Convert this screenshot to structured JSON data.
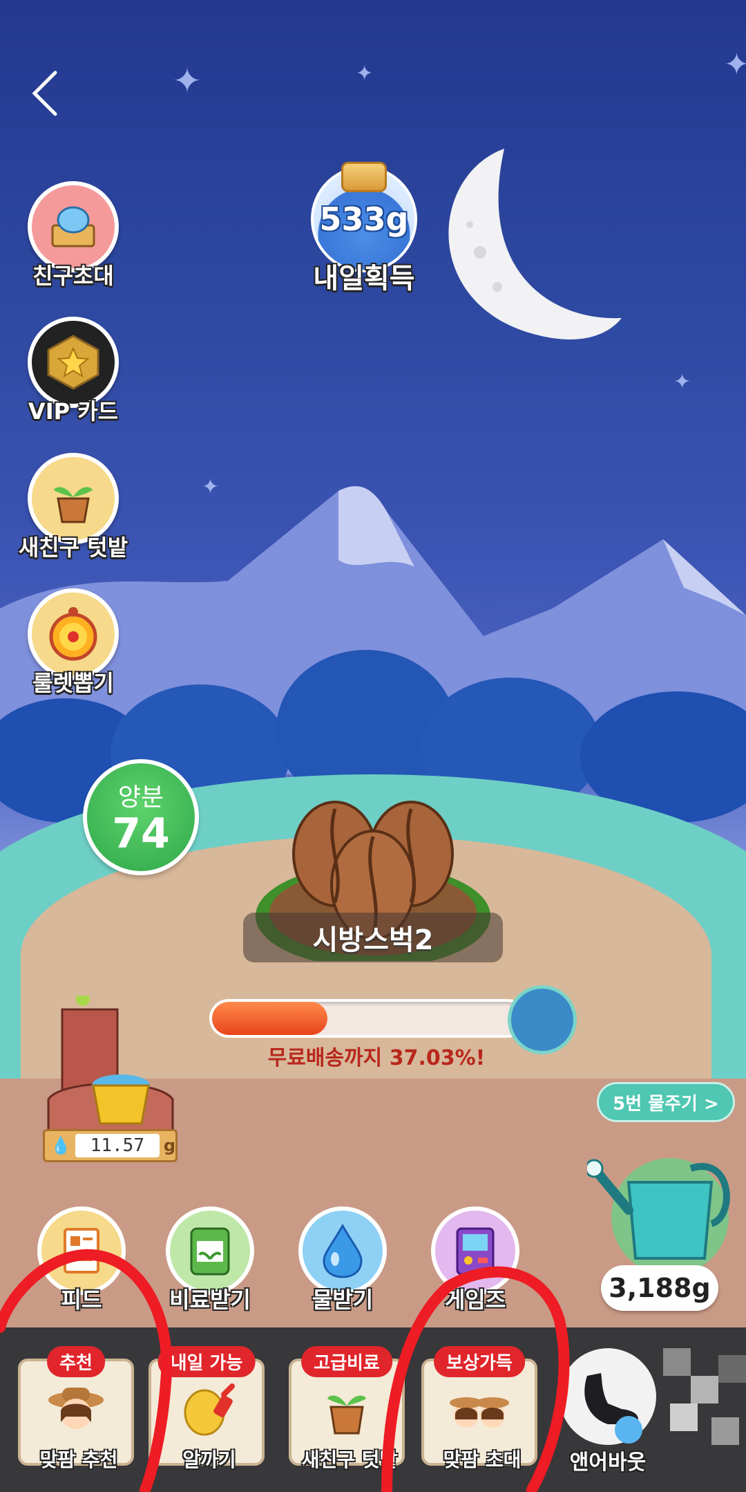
{
  "colors": {
    "annotation_red": "#ee1c24",
    "progress_fill": "#e8441c",
    "badge_red": "#e0252b",
    "nutrient_green": "#2fa84a"
  },
  "side_menu": [
    {
      "label": "친구초대",
      "icon": "treasure-chest-icon"
    },
    {
      "label": "VIP 카드",
      "icon": "star-badge-icon"
    },
    {
      "label": "새친구 텃밭",
      "icon": "sprout-pot-icon"
    },
    {
      "label": "룰렛뽑기",
      "icon": "roulette-icon"
    }
  ],
  "reward_jar": {
    "amount": "533g",
    "caption": "내일획득"
  },
  "nutrient": {
    "label": "양분",
    "value": "74"
  },
  "plant": {
    "name": "시방스벅2"
  },
  "delivery": {
    "progress": 0.3703,
    "text": "무료배송까지 37.03%!"
  },
  "water_supply": {
    "amount": "11.57",
    "unit": "g"
  },
  "water_button": {
    "label": "5번 물주기 >"
  },
  "watering_can": {
    "amount": "3,188g"
  },
  "actions": [
    {
      "label": "피드",
      "icon": "feed-card-icon"
    },
    {
      "label": "비료받기",
      "icon": "fertilizer-bag-icon"
    },
    {
      "label": "물받기",
      "icon": "water-drop-icon"
    },
    {
      "label": "게임즈",
      "icon": "arcade-icon"
    }
  ],
  "tray": [
    {
      "badge": "추천",
      "label": "맞팜 추천"
    },
    {
      "badge": "내일 가능",
      "label": "알까기"
    },
    {
      "badge": "고급비료",
      "label": "새친구 텃밭"
    },
    {
      "badge": "보상가득",
      "label": "맞팜 초대"
    }
  ],
  "tray_extra": {
    "label": "앤어바웃"
  }
}
